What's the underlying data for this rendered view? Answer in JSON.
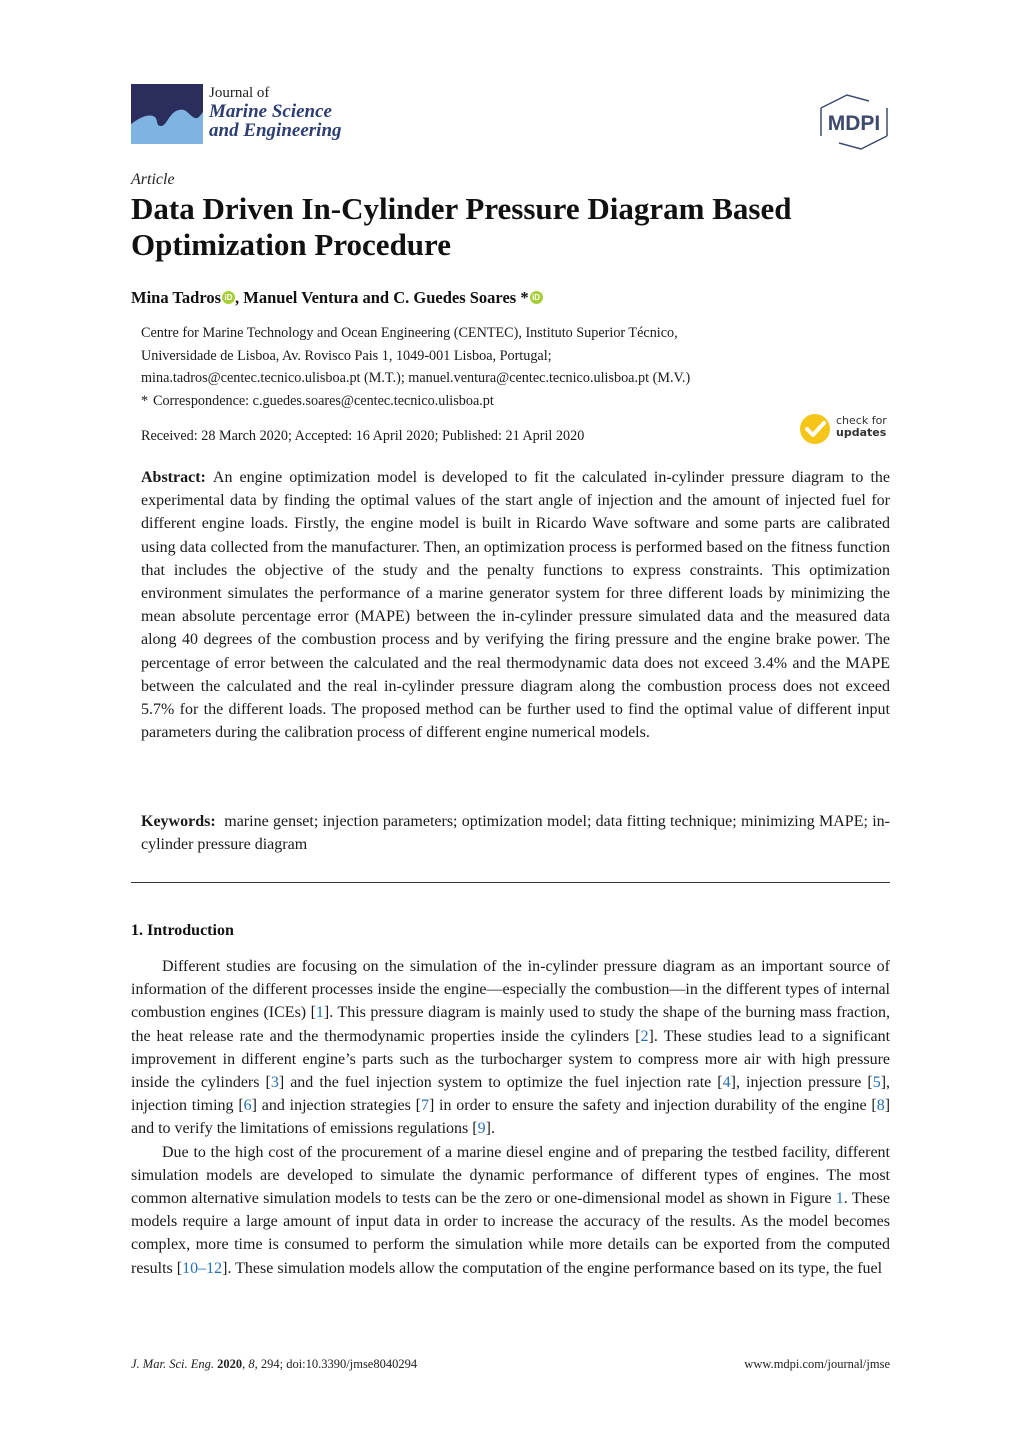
{
  "header": {
    "journal_of": "Journal of",
    "journal_line1": "Marine Science",
    "journal_line2": "and Engineering",
    "publisher_logo_text": "MDPI",
    "colors": {
      "logo_dark": "#2b2d5c",
      "logo_wave": "#7fb3e0",
      "journal_name": "#2d3e73",
      "mdpi": "#3e4a6d"
    }
  },
  "article": {
    "type": "Article",
    "title": "Data Driven In-Cylinder Pressure Diagram Based Optimization Procedure"
  },
  "authors": {
    "list": [
      {
        "name": "Mina Tadros",
        "orcid": true,
        "separator": ", "
      },
      {
        "name": "Manuel Ventura",
        "orcid": false,
        "separator": " and "
      },
      {
        "name": "C. Guedes Soares *",
        "orcid": true,
        "separator": ""
      }
    ],
    "orcid_label": "iD",
    "affiliation_lines": [
      "Centre for Marine Technology and Ocean Engineering (CENTEC), Instituto Superior Técnico,",
      "Universidade de Lisboa, Av. Rovisco Pais 1, 1049-001 Lisboa, Portugal;",
      "mina.tadros@centec.tecnico.ulisboa.pt (M.T.); manuel.ventura@centec.tecnico.ulisboa.pt (M.V.)"
    ],
    "correspondence_star": "*",
    "correspondence": "Correspondence: c.guedes.soares@centec.tecnico.ulisboa.pt"
  },
  "dates": {
    "text": "Received: 28 March 2020; Accepted: 16 April 2020; Published: 21 April 2020",
    "check_updates_line1": "check for",
    "check_updates_line2": "updates"
  },
  "abstract": {
    "label": "Abstract:",
    "text": "An engine optimization model is developed to fit the calculated in-cylinder pressure diagram to the experimental data by finding the optimal values of the start angle of injection and the amount of injected fuel for different engine loads. Firstly, the engine model is built in Ricardo Wave software and some parts are calibrated using data collected from the manufacturer. Then, an optimization process is performed based on the fitness function that includes the objective of the study and the penalty functions to express constraints. This optimization environment simulates the performance of a marine generator system for three different loads by minimizing the mean absolute percentage error (MAPE) between the in-cylinder pressure simulated data and the measured data along 40 degrees of the combustion process and by verifying the firing pressure and the engine brake power. The percentage of error between the calculated and the real thermodynamic data does not exceed 3.4% and the MAPE between the calculated and the real in-cylinder pressure diagram along the combustion process does not exceed 5.7% for the different loads. The proposed method can be further used to find the optimal value of different input parameters during the calibration process of different engine numerical models."
  },
  "keywords": {
    "label": "Keywords:",
    "text": "marine genset; injection parameters; optimization model; data fitting technique; minimizing MAPE; in-cylinder pressure diagram"
  },
  "section": {
    "heading": "1. Introduction",
    "paragraphs": [
      {
        "segments": [
          {
            "t": "Different studies are focusing on the simulation of the in-cylinder pressure diagram as an important source of information of the different processes inside the engine—especially the combustion—in the different types of internal combustion engines (ICEs) ["
          },
          {
            "ref": "1"
          },
          {
            "t": "]. This pressure diagram is mainly used to study the shape of the burning mass fraction, the heat release rate and the thermodynamic properties inside the cylinders ["
          },
          {
            "ref": "2"
          },
          {
            "t": "]. These studies lead to a significant improvement in different engine’s parts such as the turbocharger system to compress more air with high pressure inside the cylinders ["
          },
          {
            "ref": "3"
          },
          {
            "t": "] and the fuel injection system to optimize the fuel injection rate ["
          },
          {
            "ref": "4"
          },
          {
            "t": "], injection pressure ["
          },
          {
            "ref": "5"
          },
          {
            "t": "], injection timing ["
          },
          {
            "ref": "6"
          },
          {
            "t": "] and injection strategies ["
          },
          {
            "ref": "7"
          },
          {
            "t": "] in order to ensure the safety and injection durability of the engine ["
          },
          {
            "ref": "8"
          },
          {
            "t": "] and to verify the limitations of emissions regulations ["
          },
          {
            "ref": "9"
          },
          {
            "t": "]."
          }
        ]
      },
      {
        "segments": [
          {
            "t": "Due to the high cost of the procurement of a marine diesel engine and of preparing the testbed facility, different simulation models are developed to simulate the dynamic performance of different types of engines. The most common alternative simulation models to tests can be the zero or one-dimensional model as shown in Figure "
          },
          {
            "ref": "1"
          },
          {
            "t": ". These models require a large amount of input data in order to increase the accuracy of the results. As the model becomes complex, more time is consumed to perform the simulation while more details can be exported from the computed results ["
          },
          {
            "ref": "10–12"
          },
          {
            "t": "]. These simulation models allow the computation of the engine performance based on its type, the fuel"
          }
        ]
      }
    ],
    "link_color": "#2470b3"
  },
  "footer": {
    "journal_abbrev": "J. Mar. Sci. Eng.",
    "year": "2020",
    "volume": "8",
    "rest": ", 294; doi:10.3390/jmse8040294",
    "url": "www.mdpi.com/journal/jmse"
  }
}
